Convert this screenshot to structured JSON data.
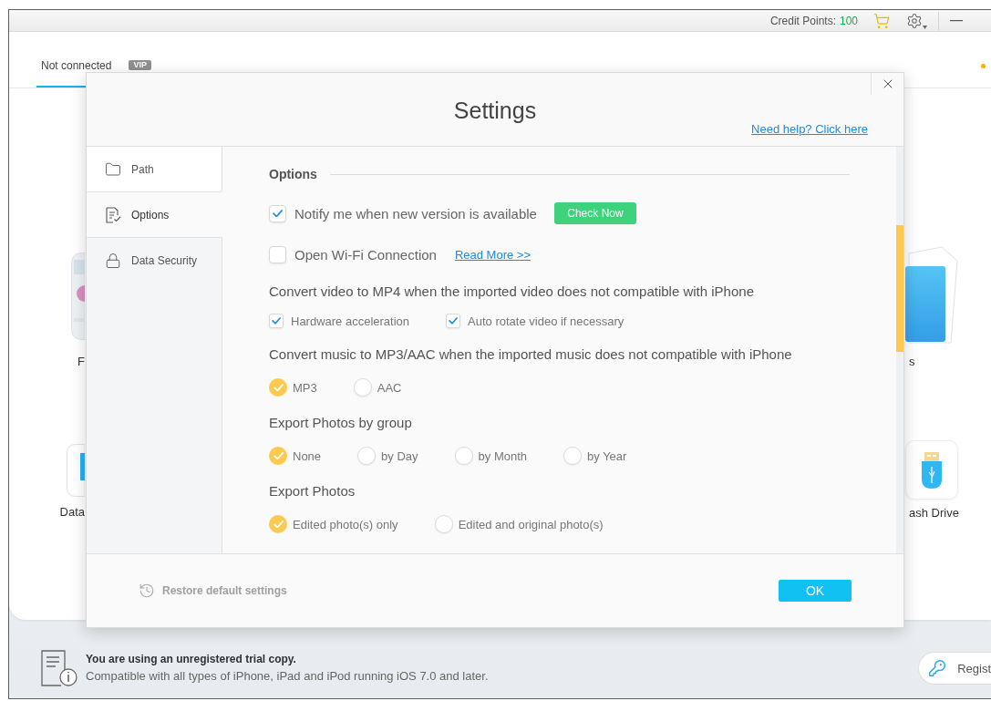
{
  "app": {
    "credit_label": "Credit Points:",
    "credit_value": "100",
    "tab": {
      "label": "Not connected",
      "selected": true
    },
    "vip_badge": "VIP",
    "home_tiles": {
      "left": [
        {
          "kind": "photos",
          "label": "F"
        },
        {
          "kind": "data",
          "label": "Data"
        }
      ],
      "right": [
        {
          "kind": "files",
          "label": "s"
        },
        {
          "kind": "usb",
          "label": "ash Drive"
        }
      ]
    },
    "status": {
      "title": "You are using an unregistered trial copy.",
      "text": "Compatible with all types of iPhone, iPad and iPod running iOS 7.0 and later."
    },
    "register_button": "Regist"
  },
  "dialog": {
    "title": "Settings",
    "help_link": "Need help? Click here",
    "sidebar": [
      {
        "kind": "folder",
        "label": "Path",
        "selected": false,
        "hovered": true
      },
      {
        "kind": "document",
        "label": "Options",
        "selected": true,
        "hovered": false
      },
      {
        "kind": "lock",
        "label": "Data Security",
        "selected": false,
        "hovered": false
      }
    ],
    "section": {
      "heading": "Options",
      "items": [
        {
          "kind": "toggle",
          "label": "Notify me when new version is available",
          "checked": true,
          "button": "Check Now"
        },
        {
          "kind": "toggle",
          "label": "Open Wi-Fi Connection",
          "checked": false,
          "link": "Read More >>"
        },
        {
          "kind": "checkbox_group",
          "title": "Convert video to MP4 when the imported video does not compatible with iPhone",
          "choices": [
            {
              "label": "Hardware acceleration",
              "checked": true
            },
            {
              "label": "Auto rotate video if necessary",
              "checked": true
            }
          ]
        },
        {
          "kind": "radio_group",
          "title": "Convert music to MP3/AAC when the imported music does not compatible with iPhone",
          "choices": [
            {
              "label": "MP3",
              "selected": true
            },
            {
              "label": "AAC",
              "selected": false
            }
          ]
        },
        {
          "kind": "radio_group",
          "title": "Export Photos by group",
          "choices": [
            {
              "label": "None",
              "selected": true
            },
            {
              "label": "by Day",
              "selected": false
            },
            {
              "label": "by Month",
              "selected": false
            },
            {
              "label": "by Year",
              "selected": false
            }
          ]
        },
        {
          "kind": "radio_group",
          "title": "Export Photos",
          "choices": [
            {
              "label": "Edited photo(s) only",
              "selected": true
            },
            {
              "label": "Edited and original photo(s)",
              "selected": false
            }
          ]
        }
      ]
    },
    "restore_button": "Restore default settings",
    "ok_button": "OK"
  }
}
